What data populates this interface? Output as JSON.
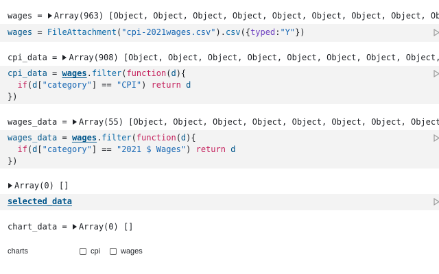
{
  "cells": {
    "wages": {
      "output_name": "wages",
      "output_value": "Array(963) [Object, Object, Object, Object, Object, Object, Object, Object, Object, Obj",
      "code_name": "wages",
      "code_fn": "FileAttachment",
      "code_arg": "\"cpi-2021wages.csv\"",
      "code_method": "csv",
      "code_opt_key": "typed",
      "code_opt_val": "\"Y\""
    },
    "cpi_data": {
      "output_name": "cpi_data",
      "output_value": "Array(908) [Object, Object, Object, Object, Object, Object, Object, Object, Object,",
      "code_name": "cpi_data",
      "code_ref": "wages",
      "code_method": "filter",
      "code_kw_function": "function",
      "code_param": "d",
      "code_if": "if",
      "code_key": "\"category\"",
      "code_value": "\"CPI\"",
      "code_return": "return",
      "code_close": "})"
    },
    "wages_data": {
      "output_name": "wages_data",
      "output_value": "Array(55) [Object, Object, Object, Object, Object, Object, Object, Object, Object,",
      "code_name": "wages_data",
      "code_ref": "wages",
      "code_method": "filter",
      "code_kw_function": "function",
      "code_param": "d",
      "code_if": "if",
      "code_key": "\"category\"",
      "code_value": "\"2021 $ Wages\"",
      "code_return": "return",
      "code_close": "})"
    },
    "selected_data": {
      "output_value": "Array(0) []",
      "code_ref": "selected_data"
    },
    "chart_data": {
      "output_name": "chart_data",
      "output_value": "Array(0) []"
    }
  },
  "charts": {
    "label": "charts",
    "options": [
      {
        "label": "cpi",
        "checked": false
      },
      {
        "label": "wages",
        "checked": false
      }
    ]
  },
  "colors": {
    "cell_background": "#f3f3f3",
    "variable": "#00568b",
    "keyword": "#c41f5b",
    "string": "#1a7bd4",
    "property": "#6f42c1"
  },
  "icons": {
    "run": "play-icon",
    "expand": "disclosure-triangle-icon"
  }
}
